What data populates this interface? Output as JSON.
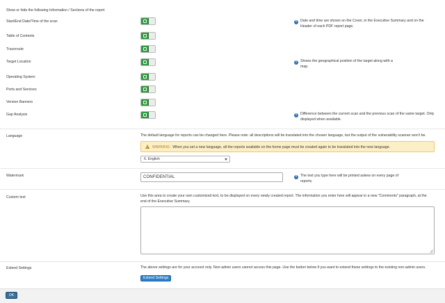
{
  "report_sections": {
    "heading": "Show or hide the following Information / Sections of the report",
    "items": [
      {
        "label": "Start/End Date/Time of the scan",
        "enabled": true
      },
      {
        "label": "Table of Contents",
        "enabled": true
      },
      {
        "label": "Traceroute",
        "enabled": true
      },
      {
        "label": "Target Location",
        "enabled": true
      },
      {
        "label": "Operating System",
        "enabled": true
      },
      {
        "label": "Ports and Services",
        "enabled": true
      },
      {
        "label": "Version Banners",
        "enabled": true
      },
      {
        "label": "Gap Analysis",
        "enabled": true
      }
    ],
    "info": {
      "start_end": "Date and time are shown on the Cover, in the Executive Summary and on the Header of each PDF report page.",
      "target_location": "Shows the geographical position of the target along with a map.",
      "gap_analysis": "Difference between the current scan and the previous scan of the same target. Only displayed when available."
    }
  },
  "language": {
    "label": "Language",
    "description": "The default language for reports can be changed here. Please note: all descriptions will be translated into the chosen language, but the output of the vulnerability scanner won't be.",
    "warning_tag": "WARNING:",
    "warning_text": "When you set a new language, all the reports available on the home page must be created again to be translated into the new language.",
    "selected": "6. English"
  },
  "watermark": {
    "label": "Watermark",
    "value": "CONFIDENTIAL",
    "info": "The text you type here will be printed askew on every page of reports."
  },
  "custom_text": {
    "label": "Custom text",
    "description": "Use this area to create your own customized text, to be displayed on every newly created report. The information you enter here will appear in a new \"Comments\" paragraph, at the end of the Executive Summary.",
    "value": ""
  },
  "extend_settings": {
    "label": "Extend Settings",
    "description": "The above settings are for your account only. Non-admin users cannot access this page. Use the button below if you want to extend these settings to the existing non-admin users.",
    "button_label": "Extend Settings"
  },
  "footer": {
    "ok_label": "OK"
  },
  "colors": {
    "toggle_on": "#2e9b3e",
    "info_icon": "#2f6db3",
    "warning_bg": "#fbefc6",
    "button_blue": "#2c82c9",
    "ok_button": "#3b6e99"
  }
}
